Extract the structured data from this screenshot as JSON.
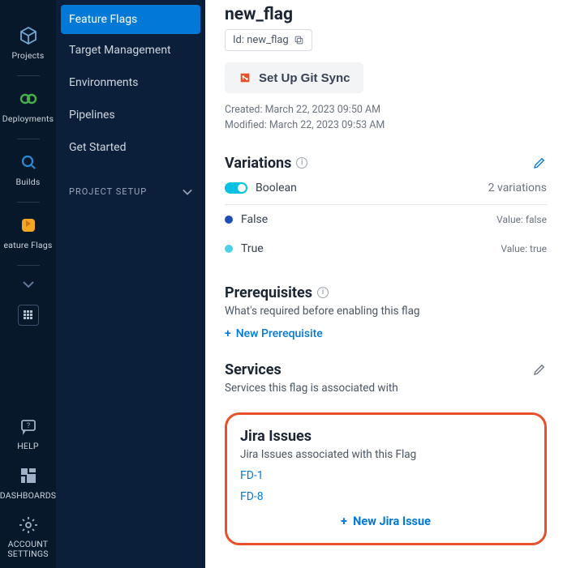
{
  "rail": {
    "items": [
      {
        "name": "projects",
        "label": "Projects"
      },
      {
        "name": "deployments",
        "label": "Deployments"
      },
      {
        "name": "builds",
        "label": "Builds"
      },
      {
        "name": "feature-flags",
        "label": "eature Flags"
      }
    ],
    "help_label": "HELP",
    "dashboards_label": "DASHBOARDS",
    "settings_label": "ACCOUNT SETTINGS"
  },
  "sidebar": {
    "items": [
      {
        "label": "Feature Flags",
        "active": true
      },
      {
        "label": "Target Management"
      },
      {
        "label": "Environments"
      },
      {
        "label": "Pipelines"
      },
      {
        "label": "Get Started"
      }
    ],
    "setup_label": "PROJECT SETUP"
  },
  "flag": {
    "title": "new_flag",
    "id_label": "Id: new_flag",
    "git_sync_label": "Set Up Git Sync",
    "created_label": "Created: March 22, 2023 09:50 AM",
    "modified_label": "Modified: March 22, 2023 09:53 AM"
  },
  "variations": {
    "title": "Variations",
    "type_label": "Boolean",
    "count_label": "2 variations",
    "items": [
      {
        "label": "False",
        "value_label": "Value: false"
      },
      {
        "label": "True",
        "value_label": "Value: true"
      }
    ]
  },
  "prerequisites": {
    "title": "Prerequisites",
    "sub": "What's required before enabling this flag",
    "new_label": "New Prerequisite"
  },
  "services": {
    "title": "Services",
    "sub": "Services this flag is associated with"
  },
  "jira": {
    "title": "Jira Issues",
    "sub": "Jira Issues associated with this Flag",
    "issues": [
      "FD-1",
      "FD-8"
    ],
    "new_label": "New Jira Issue"
  }
}
